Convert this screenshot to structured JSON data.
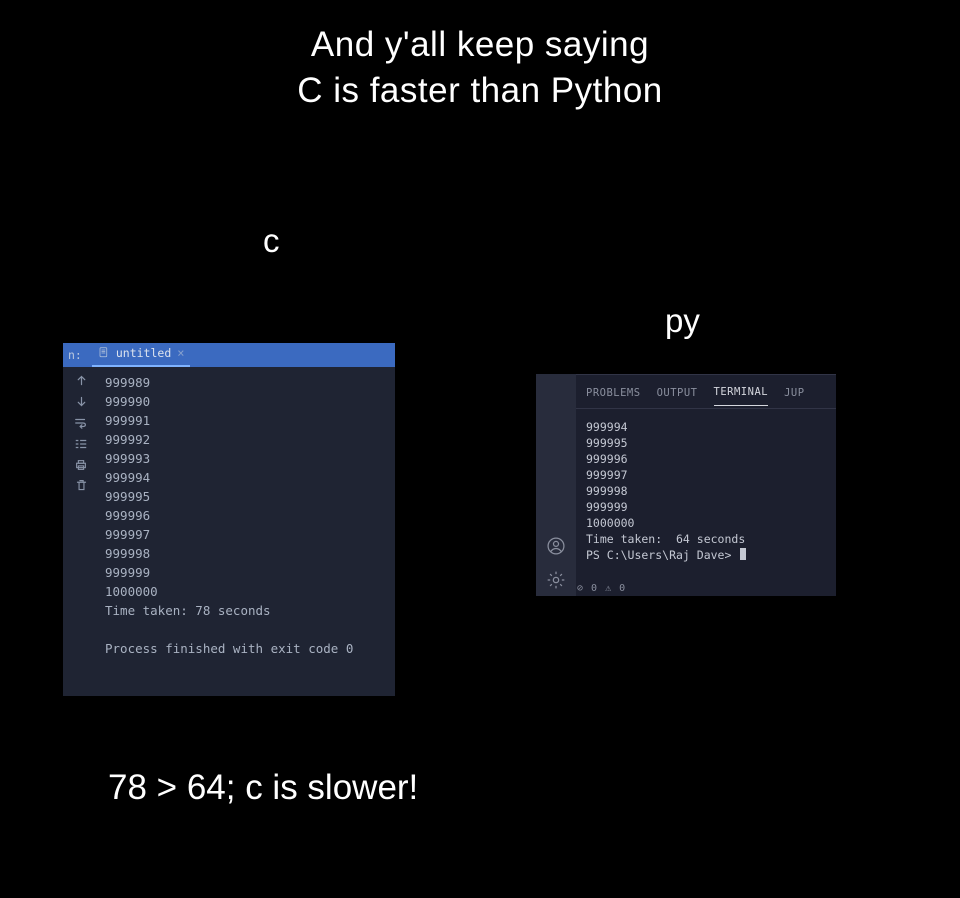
{
  "meme": {
    "title_line1": "And y'all keep saying",
    "title_line2": "C is faster than Python",
    "label_c": "c",
    "label_py": "py",
    "punchline": "78 > 64; c is slower!"
  },
  "c_window": {
    "toolbar_run_label": "n:",
    "tab_title": "untitled",
    "gutter_icons": [
      "arrow-up",
      "arrow-down",
      "wrap",
      "stack",
      "print",
      "trash"
    ],
    "output_lines": [
      "999989",
      "999990",
      "999991",
      "999992",
      "999993",
      "999994",
      "999995",
      "999996",
      "999997",
      "999998",
      "999999",
      "1000000",
      "Time taken: 78 seconds",
      "",
      "Process finished with exit code 0"
    ]
  },
  "py_window": {
    "tabs": {
      "problems": "PROBLEMS",
      "output": "OUTPUT",
      "terminal": "TERMINAL",
      "jupyter": "JUP"
    },
    "activity_icons": [
      "account",
      "gear"
    ],
    "terminal_lines": [
      "999994",
      "999995",
      "999996",
      "999997",
      "999998",
      "999999",
      "1000000",
      "Time taken:  64 seconds"
    ],
    "prompt": "PS C:\\Users\\Raj Dave> ",
    "status_icons_text": "⊘ 0 ⚠ 0"
  }
}
